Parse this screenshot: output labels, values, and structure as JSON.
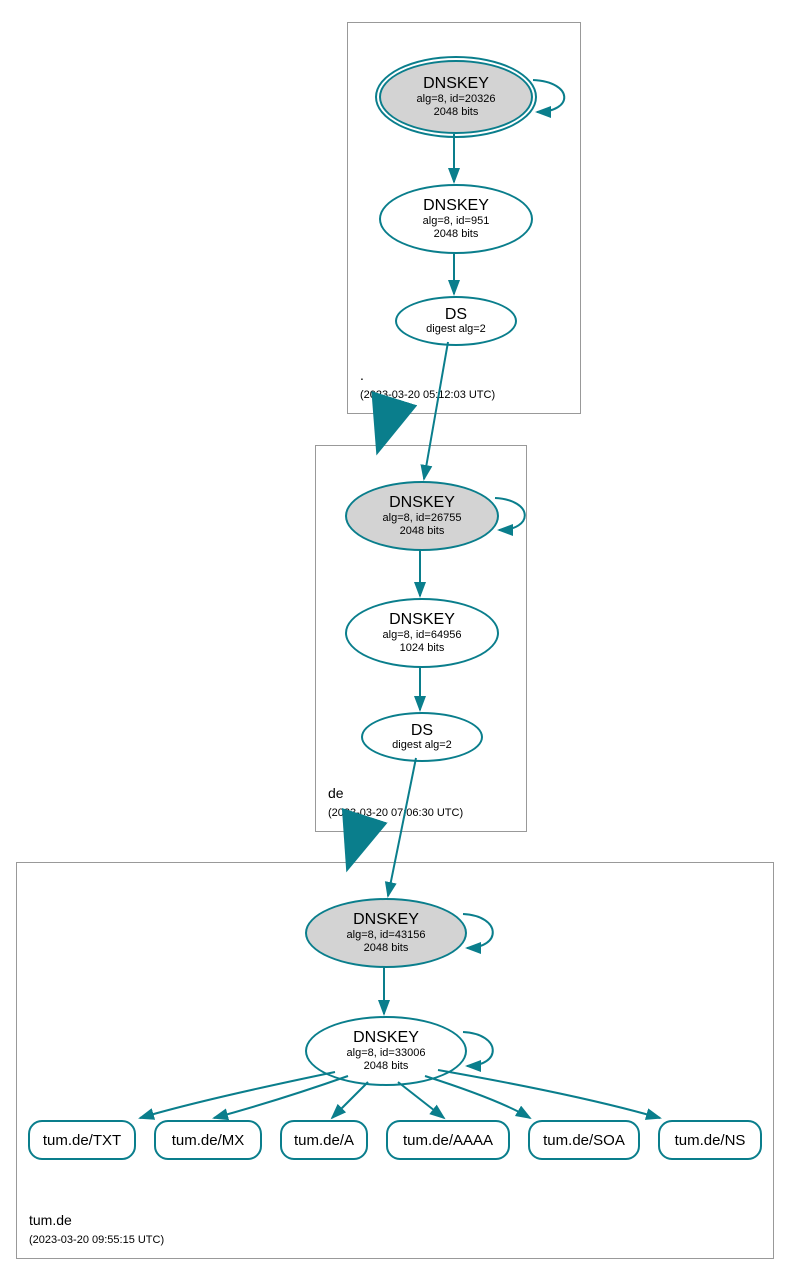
{
  "colors": {
    "stroke": "#0a7e8c",
    "ksk_fill": "#d3d3d3"
  },
  "zones": {
    "root": {
      "name": ".",
      "ts": "(2023-03-20 05:12:03 UTC)"
    },
    "de": {
      "name": "de",
      "ts": "(2023-03-20 07:06:30 UTC)"
    },
    "tum": {
      "name": "tum.de",
      "ts": "(2023-03-20 09:55:15 UTC)"
    }
  },
  "nodes": {
    "root_ksk": {
      "title": "DNSKEY",
      "sub1": "alg=8, id=20326",
      "sub2": "2048 bits"
    },
    "root_zsk": {
      "title": "DNSKEY",
      "sub1": "alg=8, id=951",
      "sub2": "2048 bits"
    },
    "root_ds": {
      "title": "DS",
      "sub1": "digest alg=2"
    },
    "de_ksk": {
      "title": "DNSKEY",
      "sub1": "alg=8, id=26755",
      "sub2": "2048 bits"
    },
    "de_zsk": {
      "title": "DNSKEY",
      "sub1": "alg=8, id=64956",
      "sub2": "1024 bits"
    },
    "de_ds": {
      "title": "DS",
      "sub1": "digest alg=2"
    },
    "tum_ksk": {
      "title": "DNSKEY",
      "sub1": "alg=8, id=43156",
      "sub2": "2048 bits"
    },
    "tum_zsk": {
      "title": "DNSKEY",
      "sub1": "alg=8, id=33006",
      "sub2": "2048 bits"
    }
  },
  "rr": {
    "txt": "tum.de/TXT",
    "mx": "tum.de/MX",
    "a": "tum.de/A",
    "aaaa": "tum.de/AAAA",
    "soa": "tum.de/SOA",
    "ns": "tum.de/NS"
  }
}
